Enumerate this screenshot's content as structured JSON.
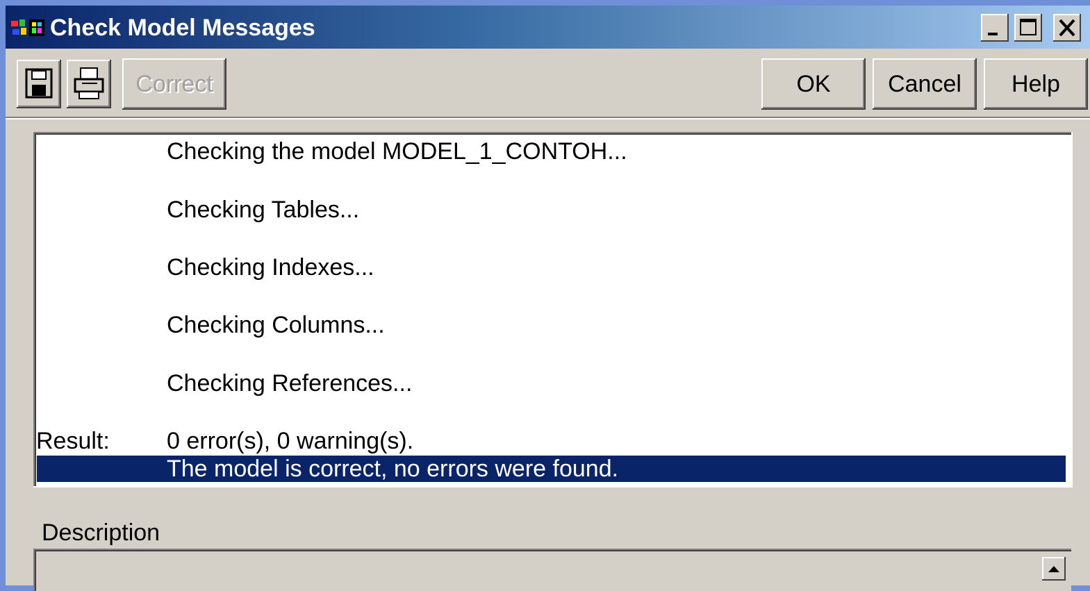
{
  "window": {
    "title": "Check Model Messages",
    "controls": {
      "minimize": "minimize-icon",
      "maximize": "maximize-icon",
      "close": "close-icon"
    }
  },
  "toolbar": {
    "save_icon": "save-icon",
    "print_icon": "print-icon",
    "correct_label": "Correct",
    "ok_label": "OK",
    "cancel_label": "Cancel",
    "help_label": "Help"
  },
  "messages": [
    {
      "label": "",
      "text": "Checking the model MODEL_1_CONTOH..."
    },
    {
      "label": "",
      "text": "Checking Tables..."
    },
    {
      "label": "",
      "text": "Checking Indexes..."
    },
    {
      "label": "",
      "text": "Checking Columns..."
    },
    {
      "label": "",
      "text": "Checking References..."
    },
    {
      "label": "Result:",
      "text": "0 error(s), 0 warning(s)."
    },
    {
      "label": "",
      "text": "The model is correct, no errors were found.",
      "selected": true
    }
  ],
  "description": {
    "label": "Description",
    "value": ""
  },
  "colors": {
    "titlebar_start": "#0a246a",
    "titlebar_end": "#a6caf0",
    "selection": "#0a246a",
    "face": "#d4d0c8"
  }
}
